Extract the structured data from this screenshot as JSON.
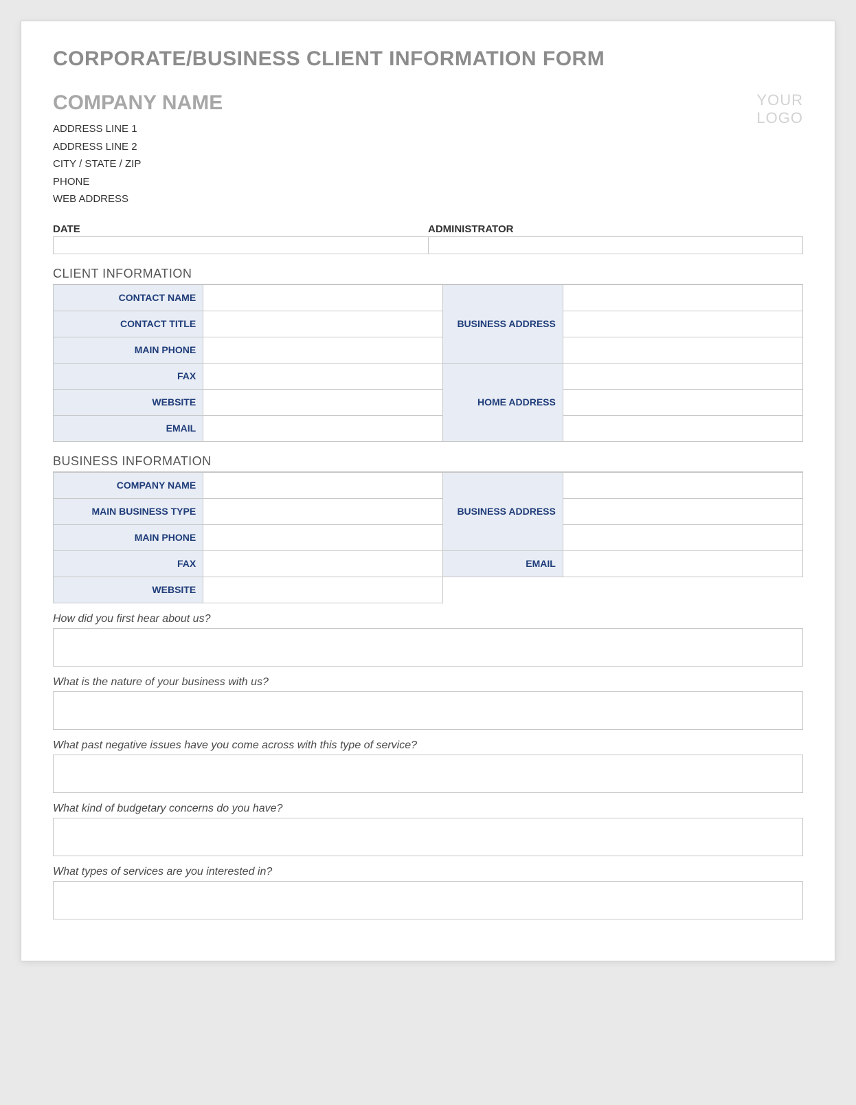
{
  "formTitle": "CORPORATE/BUSINESS CLIENT INFORMATION FORM",
  "company": {
    "name": "COMPANY NAME",
    "lines": [
      "ADDRESS LINE 1",
      "ADDRESS LINE 2",
      "CITY / STATE / ZIP",
      "PHONE",
      "WEB ADDRESS"
    ]
  },
  "logo": {
    "line1": "YOUR",
    "line2": "LOGO"
  },
  "meta": {
    "date": "DATE",
    "admin": "ADMINISTRATOR"
  },
  "clientSection": {
    "title": "CLIENT INFORMATION",
    "left": [
      "CONTACT NAME",
      "CONTACT TITLE",
      "MAIN PHONE",
      "FAX",
      "WEBSITE",
      "EMAIL"
    ],
    "rightTop": "BUSINESS ADDRESS",
    "rightBottom": "HOME ADDRESS"
  },
  "businessSection": {
    "title": "BUSINESS INFORMATION",
    "left": [
      "COMPANY NAME",
      "MAIN BUSINESS TYPE",
      "MAIN PHONE",
      "FAX",
      "WEBSITE"
    ],
    "rightTop": "BUSINESS ADDRESS",
    "rightEmail": "EMAIL"
  },
  "questions": [
    "How did you first hear about us?",
    "What is the nature of your business with us?",
    "What past negative issues have you come across with this type of service?",
    "What kind of budgetary concerns do you have?",
    "What types of services are you interested in?"
  ]
}
